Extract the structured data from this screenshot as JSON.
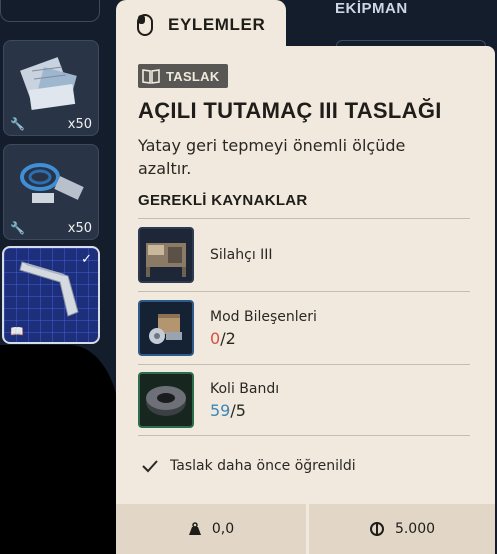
{
  "header": {
    "equipment_label": "EKİPMAN",
    "actions_tab_label": "EYLEMLER"
  },
  "inventory": {
    "slots": [
      {
        "quantity": "x50",
        "icon": "metal-parts-icon"
      },
      {
        "quantity": "x50",
        "icon": "wires-icon"
      },
      {
        "quantity": "",
        "icon": "angled-grip-icon",
        "selected": true,
        "checked": true
      }
    ]
  },
  "tooltip": {
    "badge_label": "TASLAK",
    "title": "AÇILI TUTAMAÇ III TASLAĞI",
    "description": "Yatay geri tepmeyi önemli ölçüde azaltır.",
    "requirements_title": "GEREKLİ KAYNAKLAR",
    "requirements": [
      {
        "name": "Silahçı III",
        "icon": "workbench-icon"
      },
      {
        "name": "Mod Bileşenleri",
        "have": "0",
        "need": "/2",
        "icon": "mod-components-icon"
      },
      {
        "name": "Koli Bandı",
        "have": "59",
        "need": "/5",
        "icon": "duct-tape-icon"
      }
    ],
    "learned_text": "Taslak daha önce öğrenildi",
    "weight": "0,0",
    "price": "5.000"
  },
  "colors": {
    "card_bg": "#f1e9dd",
    "footer_bg": "#e2d7c6",
    "insufficient": "#d7513f",
    "sufficient": "#3a86b8"
  }
}
